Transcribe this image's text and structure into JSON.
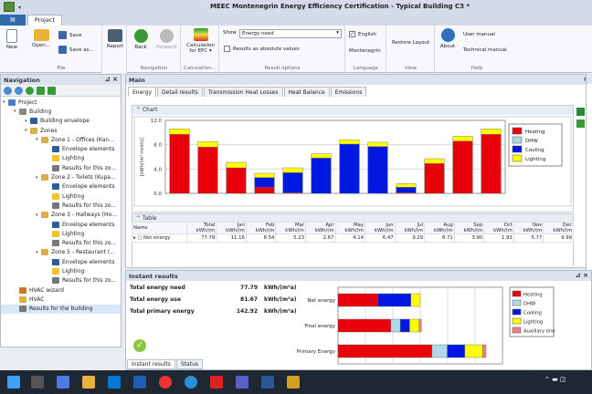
{
  "window": {
    "title": "MEEC Montenegrin Energy Efficiency Certification - Typical Building C3 *"
  },
  "tabs": {
    "file": "",
    "project": "Project"
  },
  "ribbon": {
    "file": {
      "new": "New",
      "open": "Open...",
      "save": "Save",
      "save_as": "Save as...",
      "group": "File"
    },
    "report": {
      "label": "Report"
    },
    "nav": {
      "back": "Back",
      "forward": "Forward",
      "group": "Navigation"
    },
    "calc": {
      "label": "Calculation for EPC",
      "group": "Calculation..."
    },
    "results": {
      "show_label": "Show",
      "show_value": "Energy need",
      "abs_label": "Results as absolute values",
      "group": "Result options"
    },
    "language": {
      "english": "English",
      "montenegrin": "Montenegrin",
      "group": "Language"
    },
    "view": {
      "restore": "Restore Layout",
      "group": "View"
    },
    "help": {
      "about": "About",
      "user_manual": "User manual",
      "tech_manual": "Technical manual",
      "group": "Help"
    }
  },
  "navigation": {
    "title": "Navigation",
    "tree": [
      {
        "label": "Project",
        "level": 0,
        "icon": "project-icon",
        "color": "#4a7fc1"
      },
      {
        "label": "Building",
        "level": 1,
        "icon": "building-icon",
        "color": "#888"
      },
      {
        "label": "Building envelope",
        "level": 2,
        "icon": "envelope-icon",
        "color": "#2e5e9a"
      },
      {
        "label": "Zones",
        "level": 2,
        "icon": "folder-icon",
        "color": "#d8b04a"
      },
      {
        "label": "Zone 1 - Offices (Kan...",
        "level": 3,
        "icon": "zone-icon",
        "color": "#d8b04a"
      },
      {
        "label": "Envelope elements",
        "level": 4,
        "icon": "envelope-icon",
        "color": "#2e5e9a"
      },
      {
        "label": "Lighting",
        "level": 4,
        "icon": "lighting-icon",
        "color": "#f4c12b"
      },
      {
        "label": "Results for this zo...",
        "level": 4,
        "icon": "results-icon",
        "color": "#777"
      },
      {
        "label": "Zone 2 - Toilets (Kupa...",
        "level": 3,
        "icon": "zone-icon",
        "color": "#d8b04a"
      },
      {
        "label": "Envelope elements",
        "level": 4,
        "icon": "envelope-icon",
        "color": "#2e5e9a"
      },
      {
        "label": "Lighting",
        "level": 4,
        "icon": "lighting-icon",
        "color": "#f4c12b"
      },
      {
        "label": "Results for this zo...",
        "level": 4,
        "icon": "results-icon",
        "color": "#777"
      },
      {
        "label": "Zone 3 - Hallways (Ho...",
        "level": 3,
        "icon": "zone-icon",
        "color": "#d8b04a"
      },
      {
        "label": "Envelope elements",
        "level": 4,
        "icon": "envelope-icon",
        "color": "#2e5e9a"
      },
      {
        "label": "Lighting",
        "level": 4,
        "icon": "lighting-icon",
        "color": "#f4c12b"
      },
      {
        "label": "Results for this zo...",
        "level": 4,
        "icon": "results-icon",
        "color": "#777"
      },
      {
        "label": "Zone 5 - Restaurant (...",
        "level": 3,
        "icon": "zone-icon",
        "color": "#d8b04a"
      },
      {
        "label": "Envelope elements",
        "level": 4,
        "icon": "envelope-icon",
        "color": "#2e5e9a"
      },
      {
        "label": "Lighting",
        "level": 4,
        "icon": "lighting-icon",
        "color": "#f4c12b"
      },
      {
        "label": "Results for this zo...",
        "level": 4,
        "icon": "results-icon",
        "color": "#777"
      },
      {
        "label": "HVAC wizard",
        "level": 1,
        "icon": "wizard-icon",
        "color": "#c77a2b"
      },
      {
        "label": "HVAC",
        "level": 1,
        "icon": "hvac-icon",
        "color": "#d8b04a"
      },
      {
        "label": "Results for the building",
        "level": 1,
        "icon": "results-icon",
        "color": "#777",
        "selected": true
      }
    ]
  },
  "main": {
    "title": "Main",
    "tabs": [
      "Energy",
      "Detail results",
      "Transmission Heat Losses",
      "Heat Balance",
      "Emissions"
    ],
    "chart_section": "Chart",
    "table_section": "Table"
  },
  "colors": {
    "heating": "#e8000b",
    "dhw": "#b0d8e8",
    "cooling": "#0018e0",
    "lighting": "#ffff00",
    "aux": "#f08080"
  },
  "chart_data": {
    "type": "bar",
    "stacked": true,
    "categories": [
      "Jan",
      "Feb",
      "Mar",
      "Apr",
      "May",
      "Jun",
      "Jul",
      "Aug",
      "Sep",
      "Oct",
      "Nov",
      "Dec"
    ],
    "ylabel": "[kWh/(m²·mnth)]",
    "ylim": [
      0,
      12
    ],
    "yticks": [
      "0.0",
      "4.0",
      "8.0",
      "12.0"
    ],
    "legend_position": "right",
    "series": [
      {
        "name": "Heating",
        "color": "#e8000b",
        "values": [
          9.7,
          7.6,
          4.2,
          1.0,
          0.1,
          0,
          0,
          0,
          0.1,
          4.9,
          8.6,
          9.7
        ]
      },
      {
        "name": "DHW",
        "color": "#b0d8e8",
        "values": [
          0,
          0,
          0,
          0,
          0,
          0,
          0,
          0,
          0,
          0,
          0,
          0
        ]
      },
      {
        "name": "Cooling",
        "color": "#0018e0",
        "values": [
          0,
          0,
          0,
          1.6,
          3.3,
          5.8,
          8.1,
          7.7,
          0.9,
          0,
          0,
          0
        ]
      },
      {
        "name": "Lighting",
        "color": "#ffff00",
        "values": [
          0.9,
          0.9,
          0.9,
          0.7,
          0.8,
          0.7,
          0.7,
          0.7,
          0.6,
          0.8,
          0.8,
          0.9
        ]
      }
    ]
  },
  "table": {
    "headers": [
      "Name",
      "Total kWh/(m",
      "Jan kWh/(m",
      "Feb kWh/(m",
      "Mar kWh/(m",
      "Apr kWh/(m",
      "May kWh/(m",
      "Jun kWh/(m",
      "Jul kWh/(m",
      "Aug kWh/(m",
      "Sep kWh/(m",
      "Oct kWh/(m",
      "Nov kWh/(m",
      "Dec kWh/(m"
    ],
    "rows": [
      {
        "name": "Net energy",
        "values": [
          "77.79",
          "11.16",
          "8.54",
          "5.23",
          "2.67",
          "4.14",
          "6.47",
          "9.29",
          "8.71",
          "3.90",
          "1.93",
          "5.77",
          "9.99"
        ]
      }
    ]
  },
  "instant": {
    "title": "Instant results",
    "rows": [
      {
        "label": "Total energy need",
        "value": "77.79",
        "unit": "kWh/(m²a)"
      },
      {
        "label": "Total energy use",
        "value": "81.67",
        "unit": "kWh/(m²a)"
      },
      {
        "label": "Total primary energy",
        "value": "142.92",
        "unit": "kWh/(m²a)"
      }
    ],
    "tabs": [
      "Instant results",
      "Status"
    ],
    "chart_data": {
      "type": "bar",
      "orientation": "horizontal",
      "stacked": true,
      "categories": [
        "Net energy",
        "Final energy",
        "Primary Energy"
      ],
      "legend_position": "right",
      "series": [
        {
          "name": "Heating",
          "color": "#e8000b",
          "values": [
            34,
            45,
            80
          ]
        },
        {
          "name": "DHW",
          "color": "#b0d8e8",
          "values": [
            0,
            8,
            13
          ]
        },
        {
          "name": "Cooling",
          "color": "#0018e0",
          "values": [
            28,
            8,
            15
          ]
        },
        {
          "name": "Lighting",
          "color": "#ffff00",
          "values": [
            8,
            8,
            15
          ]
        },
        {
          "name": "Auxiliary energy",
          "color": "#f08080",
          "values": [
            0,
            2,
            3
          ]
        }
      ]
    }
  }
}
